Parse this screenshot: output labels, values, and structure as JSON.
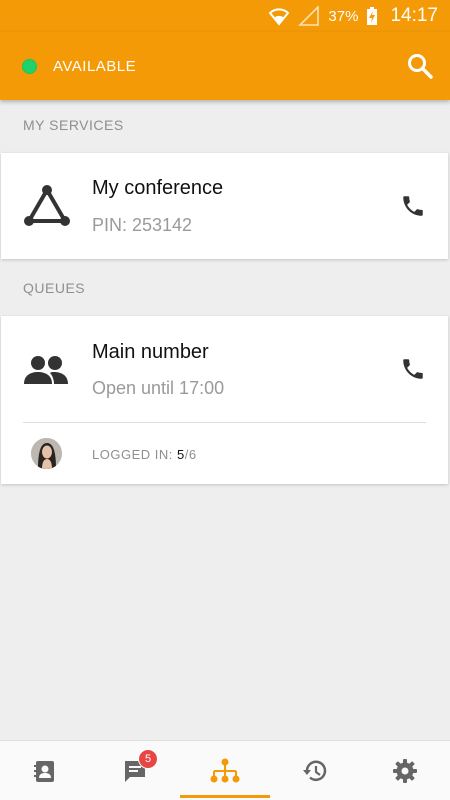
{
  "status_bar": {
    "battery": "37%",
    "time": "14:17"
  },
  "app_bar": {
    "presence_label": "AVAILABLE",
    "presence_color": "#1fd36a",
    "accent": "#f39a06"
  },
  "services": {
    "header": "MY SERVICES",
    "items": [
      {
        "title": "My conference",
        "subtitle": "PIN: 253142",
        "icon": "conference-triangle-icon"
      }
    ]
  },
  "queues": {
    "header": "QUEUES",
    "items": [
      {
        "title": "Main number",
        "subtitle": "Open until 17:00",
        "icon": "group-icon",
        "logged_label": "LOGGED IN: ",
        "logged_count": "5",
        "logged_total": "/6"
      }
    ]
  },
  "bottom_nav": {
    "items": [
      {
        "name": "contacts",
        "icon": "contacts-icon"
      },
      {
        "name": "messages",
        "icon": "chat-icon",
        "badge": "5"
      },
      {
        "name": "services",
        "icon": "org-chart-icon",
        "active": true
      },
      {
        "name": "history",
        "icon": "history-icon"
      },
      {
        "name": "settings",
        "icon": "gear-icon"
      }
    ]
  }
}
